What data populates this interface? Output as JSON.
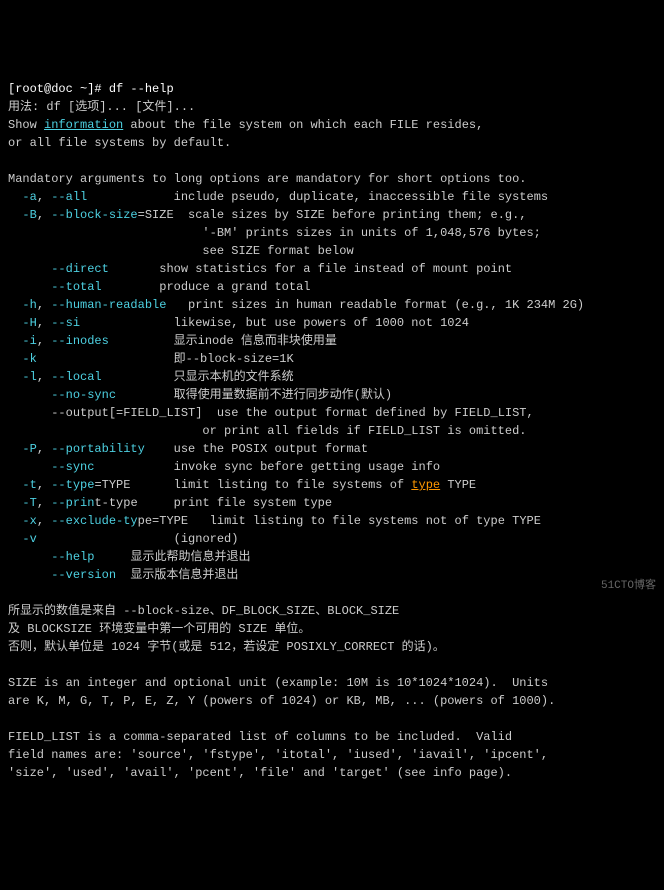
{
  "prompt": {
    "user": "[root@doc ~]# ",
    "cmd": "df --help"
  },
  "usage1": "用法: df [选项]... [文件]...",
  "usage2a": "Show ",
  "usage2b": "information",
  "usage2c": " about the file system on which each FILE resides,",
  "usage3": "or all file systems by default.",
  "para1": "Mandatory arguments to long options are mandatory for short options too.",
  "opts": {
    "a_s": "-a",
    "a_l": "--all",
    "a_d": "            include pseudo, duplicate, inaccessible file systems",
    "B_s": "-B",
    "B_l": "--block-size",
    "B_arg": "=SIZE",
    "B_d": "  scale sizes by SIZE before printing them; e.g.,",
    "B_d2": "                           '-BM' prints sizes in units of 1,048,576 bytes;",
    "B_d3": "                           see SIZE format below",
    "direct_l": "--direct",
    "direct_d": "       show statistics for a file instead of mount point",
    "total_l": "--total",
    "total_d": "        produce a grand total",
    "h_s": "-h",
    "h_l": "--human-readable",
    "h_d": "   print sizes in human readable format (e.g., 1K 234M 2G)",
    "H_s": "-H",
    "H_l": "--si",
    "H_d": "             likewise, but use powers of 1000 not 1024",
    "i_s": "-i",
    "i_l": "--inodes",
    "i_d": "         显示inode 信息而非块使用量",
    "k_s": "-k",
    "k_d": "                   即--block-size=1K",
    "l_s": "-l",
    "l_l": "--local",
    "l_d": "          只显示本机的文件系统",
    "ns_l": "--no-sync",
    "ns_d": "        取得使用量数据前不进行同步动作(默认)",
    "out_l": "--output",
    "out_arg": "[=FIELD_LIST]",
    "out_d": "  use the output format defined by FIELD_LIST,",
    "out_d2": "                           or print all fields if FIELD_LIST is omitted.",
    "P_s": "-P",
    "P_l": "--portability",
    "P_d": "    use the POSIX output format",
    "sync_l": "--sync",
    "sync_d": "           invoke sync before getting usage info",
    "t_s": "-t",
    "t_l": "--type",
    "t_arg": "=TYPE",
    "t_d1": "      limit listing to file systems of ",
    "t_d_type": "type",
    "t_d2": " TYPE",
    "T_s": "-T",
    "T_l": "--prin",
    "T_l2": "t-type",
    "T_d": "     print file system type",
    "x_s": "-x",
    "x_l": "--exclude-ty",
    "x_l2": "pe=TYPE",
    "x_d": "   limit listing to file systems not of type TYPE",
    "v_s": "-v",
    "v_d": "                   (ignored)",
    "help_l": "--help",
    "help_d": "     显示此帮助信息并退出",
    "ver_l": "--version",
    "ver_d": "  显示版本信息并退出"
  },
  "para2_l1": "所显示的数值是来自 --block-size、DF_BLOCK_SIZE、BLOCK_SIZE",
  "para2_l2": "及 BLOCKSIZE 环境变量中第一个可用的 SIZE 单位。",
  "para2_l3": "否则，默认单位是 1024 字节(或是 512，若设定 POSIXLY_CORRECT 的话)。",
  "para3_l1": "SIZE is an integer and optional unit (example: 10M is 10*1024*1024).  Units",
  "para3_l2": "are K, M, G, T, P, E, Z, Y (powers of 1024) or KB, MB, ... (powers of 1000).",
  "para4_l1": "FIELD_LIST is a comma-separated list of columns to be included.  Valid",
  "para4_l2": "field names are: 'source', 'fstype', 'itotal', 'iused', 'iavail', 'ipcent',",
  "para4_l3": "'size', 'used', 'avail', 'pcent', 'file' and 'target' (see info page).",
  "watermark": "51CTO博客"
}
